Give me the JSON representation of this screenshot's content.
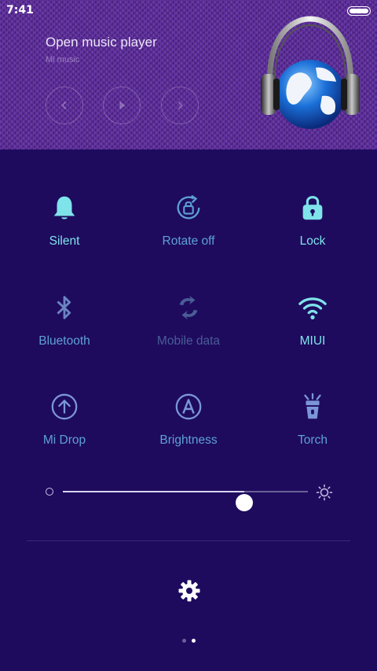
{
  "status_bar": {
    "time": "7:41"
  },
  "music_player": {
    "title": "Open music player",
    "subtitle": "Mi music"
  },
  "toggles": [
    {
      "label": "Silent",
      "icon": "bell-icon",
      "state": "active"
    },
    {
      "label": "Rotate off",
      "icon": "rotate-lock-icon",
      "state": "inactive"
    },
    {
      "label": "Lock",
      "icon": "lock-icon",
      "state": "active"
    },
    {
      "label": "Bluetooth",
      "icon": "bluetooth-icon",
      "state": "inactive"
    },
    {
      "label": "Mobile data",
      "icon": "mobile-data-icon",
      "state": "disabled"
    },
    {
      "label": "MIUI",
      "icon": "wifi-icon",
      "state": "active"
    },
    {
      "label": "Mi Drop",
      "icon": "mi-drop-icon",
      "state": "inactive"
    },
    {
      "label": "Brightness",
      "icon": "auto-brightness-icon",
      "state": "inactive"
    },
    {
      "label": "Torch",
      "icon": "torch-icon",
      "state": "inactive"
    }
  ],
  "brightness": {
    "level": 0.74
  },
  "pager": {
    "pages": 2,
    "current": 1
  },
  "colors": {
    "background": "#1e0b5e",
    "active": "#7fe3ea",
    "inactive": "#5ea0d6",
    "disabled": "#4a5d96"
  }
}
